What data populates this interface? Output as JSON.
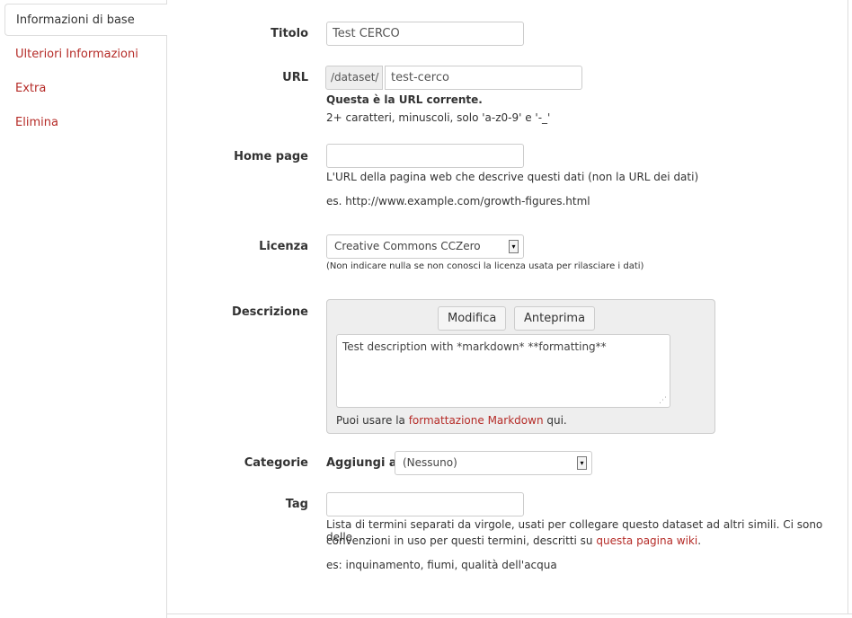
{
  "sidebar": {
    "active_tab": "Informazioni di base",
    "links": [
      "Ulteriori Informazioni",
      "Extra",
      "Elimina"
    ]
  },
  "form": {
    "title": {
      "label": "Titolo",
      "value": "Test CERCO"
    },
    "url": {
      "label": "URL",
      "prefix": "/dataset/",
      "value": "test-cerco",
      "help_strong": "Questa è la URL corrente.",
      "help": "2+ caratteri, minuscoli, solo 'a-z0-9' e '-_'"
    },
    "homepage": {
      "label": "Home page",
      "value": "",
      "help": "L'URL della pagina web che descrive questi dati (non la URL dei dati)",
      "example": "es. http://www.example.com/growth-figures.html"
    },
    "license": {
      "label": "Licenza",
      "selected": "Creative Commons CCZero",
      "help": "(Non indicare nulla se non conosci la licenza usata per rilasciare i dati)"
    },
    "description": {
      "label": "Descrizione",
      "edit_button": "Modifica",
      "preview_button": "Anteprima",
      "value": "Test description with *markdown* **formatting**",
      "help_prefix": "Puoi usare la ",
      "help_link": "formattazione Markdown",
      "help_suffix": " qui."
    },
    "categories": {
      "label": "Categorie",
      "add_label": "Aggiungi a:",
      "selected": "(Nessuno)"
    },
    "tags": {
      "label": "Tag",
      "value": "",
      "help_line1": "Lista di termini separati da virgole, usati per collegare questo dataset ad altri simili. Ci sono delle",
      "help_line2_prefix": "convenzioni in uso per questi termini, descritti su ",
      "help_link": "questa pagina wiki",
      "help_line2_suffix": ".",
      "example": "es: inquinamento, fiumi, qualità dell'acqua"
    }
  },
  "icons": {
    "select_arrow": "chevron-down-icon",
    "resize_grip": "resize-grip-icon"
  },
  "colors": {
    "link": "#b52b27",
    "border": "#dddddd",
    "panel": "#eeeeee"
  }
}
